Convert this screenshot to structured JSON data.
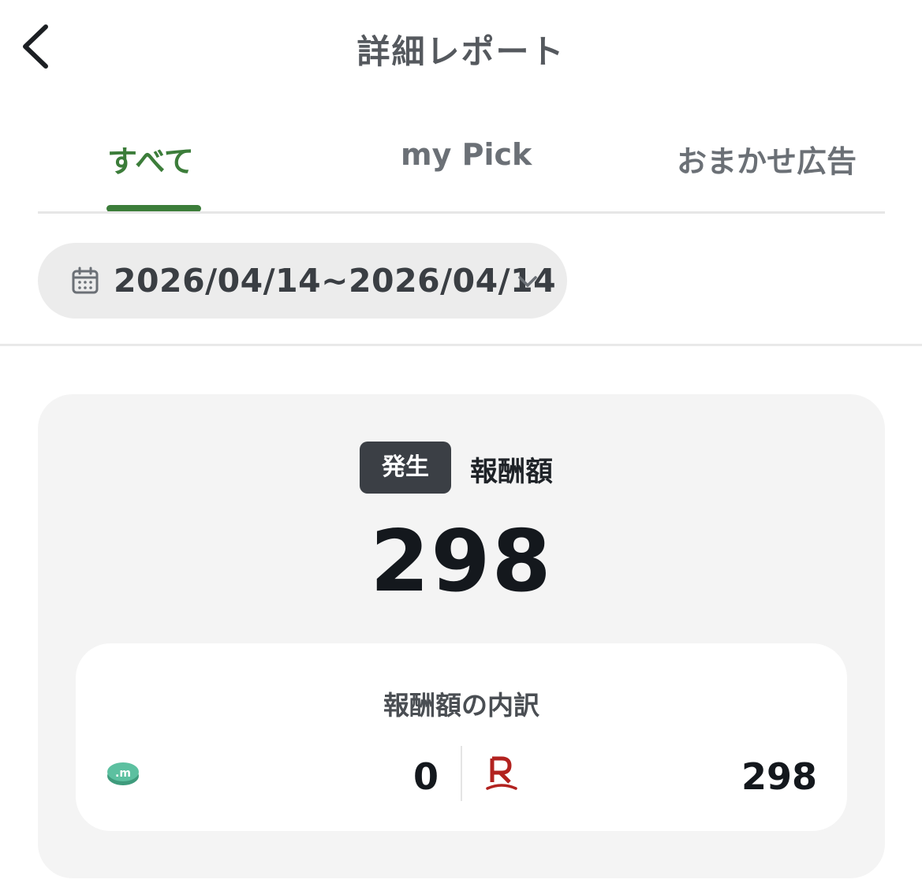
{
  "header": {
    "title": "詳細レポート"
  },
  "tabs": [
    {
      "label": "すべて",
      "active": true
    },
    {
      "label": "my Pick",
      "active": false
    },
    {
      "label": "おまかせ広告",
      "active": false
    }
  ],
  "date_filter": {
    "range": "2026/04/14~2026/04/14"
  },
  "summary": {
    "status_badge": "発生",
    "reward_label": "報酬額",
    "total_amount": "298",
    "breakdown": {
      "title": "報酬額の内訳",
      "items": [
        {
          "icon": "m-coin-icon",
          "value": "0"
        },
        {
          "icon": "rakuten-r-icon",
          "value": "298"
        }
      ]
    }
  },
  "colors": {
    "accent_green": "#3c7d3a",
    "badge_dark": "#3b3f45",
    "m_coin_teal": "#4fb392",
    "rakuten_red": "#b2221f"
  }
}
